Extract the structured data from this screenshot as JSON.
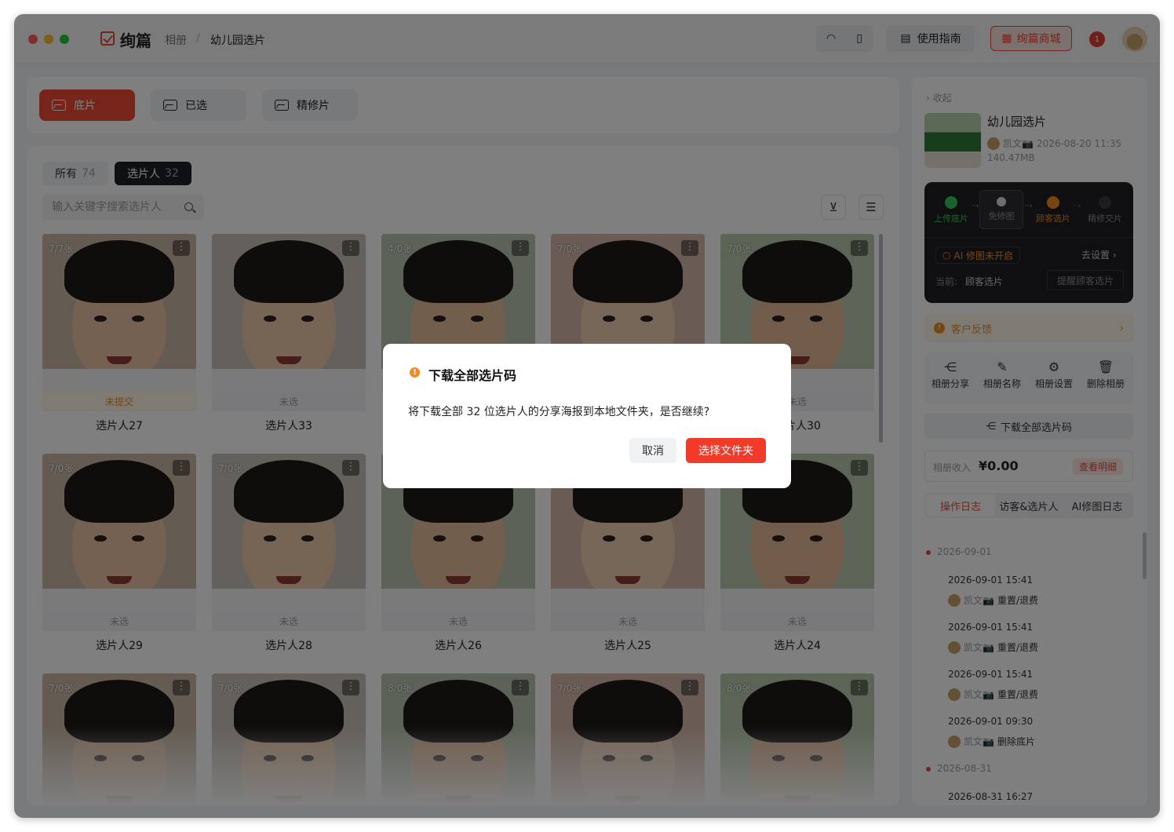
{
  "app": {
    "logo_text": "绚篇",
    "breadcrumb": [
      "相册",
      "幼儿园选片"
    ],
    "guide_label": "使用指南",
    "shop_label": "绚篇商城",
    "notification_count": "1"
  },
  "tabs": [
    {
      "label": "底片",
      "active": true
    },
    {
      "label": "已选",
      "active": false
    },
    {
      "label": "精修片",
      "active": false
    }
  ],
  "filters": {
    "all_label": "所有",
    "all_count": "74",
    "picker_label": "选片人",
    "picker_count": "32",
    "search_placeholder": "输入关键字搜索选片人"
  },
  "cards": [
    {
      "count": "7/7张",
      "status": "未提交",
      "name": "选片人27",
      "warn": true
    },
    {
      "count": "",
      "status": "未选",
      "name": "选片人33",
      "warn": false
    },
    {
      "count": "4/0张",
      "status": "",
      "name": "",
      "warn": false
    },
    {
      "count": "7/0张",
      "status": "",
      "name": "",
      "warn": false
    },
    {
      "count": "7/0张",
      "status": "未选",
      "name": "选片人30",
      "warn": false
    },
    {
      "count": "7/0张",
      "status": "未选",
      "name": "选片人29",
      "warn": false
    },
    {
      "count": "7/0张",
      "status": "未选",
      "name": "选片人28",
      "warn": false
    },
    {
      "count": "",
      "status": "未选",
      "name": "选片人26",
      "warn": false
    },
    {
      "count": "",
      "status": "未选",
      "name": "选片人25",
      "warn": false
    },
    {
      "count": "",
      "status": "未选",
      "name": "选片人24",
      "warn": false
    },
    {
      "count": "7/0张",
      "status": "",
      "name": "",
      "warn": false
    },
    {
      "count": "7/0张",
      "status": "",
      "name": "",
      "warn": false
    },
    {
      "count": "8/0张",
      "status": "",
      "name": "",
      "warn": false
    },
    {
      "count": "7/0张",
      "status": "",
      "name": "",
      "warn": false
    },
    {
      "count": "8/0张",
      "status": "",
      "name": "",
      "warn": false
    }
  ],
  "sidebar": {
    "collapse_label": "收起",
    "album_title": "幼儿园选片",
    "owner": "凯文📷",
    "date": "2026-08-20 11:35",
    "size": "140.47MB",
    "steps": [
      "上传底片",
      "免修图",
      "顾客选片",
      "精修交片"
    ],
    "ai_status": "AI 修图未开启",
    "go_settings": "去设置",
    "current_label": "当前:",
    "current_value": "顾客选片",
    "remind_label": "提醒顾客选片",
    "feedback_label": "客户反馈",
    "actions": [
      "相册分享",
      "相册名称",
      "相册设置",
      "删除相册"
    ],
    "download_label": "下载全部选片码",
    "income_label": "相册收入",
    "income_value": "¥0.00",
    "income_detail": "查看明细",
    "log_tabs": [
      "操作日志",
      "访客&选片人",
      "AI修图日志"
    ],
    "log_groups": [
      {
        "date": "2026-09-01",
        "entries": [
          {
            "time": "2026-09-01 15:41",
            "who": "凯文📷",
            "action": "重置/退费"
          },
          {
            "time": "2026-09-01 15:41",
            "who": "凯文📷",
            "action": "重置/退费"
          },
          {
            "time": "2026-09-01 15:41",
            "who": "凯文📷",
            "action": "重置/退费"
          },
          {
            "time": "2026-09-01 09:30",
            "who": "凯文📷",
            "action": "删除底片"
          }
        ]
      },
      {
        "date": "2026-08-31",
        "entries": [
          {
            "time": "2026-08-31 16:27",
            "who": "",
            "action": ""
          }
        ]
      }
    ]
  },
  "modal": {
    "title": "下载全部选片码",
    "body": "将下载全部 32 位选片人的分享海报到本地文件夹，是否继续?",
    "cancel_label": "取消",
    "confirm_label": "选择文件夹"
  },
  "colors": {
    "accent": "#ef4a35",
    "warning": "#ef8a25",
    "dark_panel": "#1e1f24"
  }
}
